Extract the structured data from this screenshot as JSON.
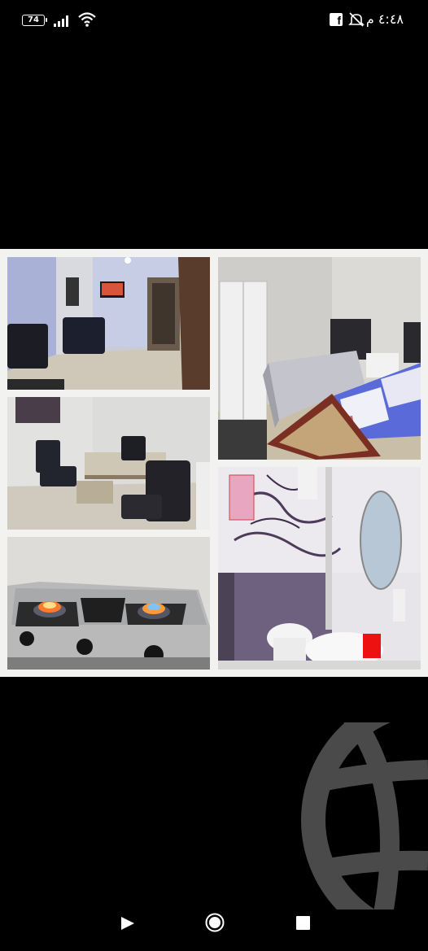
{
  "status_bar": {
    "battery_level": "74",
    "time": "٤:٤٨ م",
    "icons": [
      "battery-icon",
      "signal-icon",
      "wifi-icon",
      "facebook-icon",
      "mute-icon"
    ]
  },
  "content": {
    "image_description_icons": [
      "living-room-photo",
      "bedroom-photo",
      "office-photo",
      "bathroom-photo",
      "gas-stove-photo"
    ],
    "watermark": "globe-icon"
  },
  "navigation_bar": {
    "buttons": [
      "back-button",
      "home-button",
      "recent-apps-button"
    ]
  }
}
